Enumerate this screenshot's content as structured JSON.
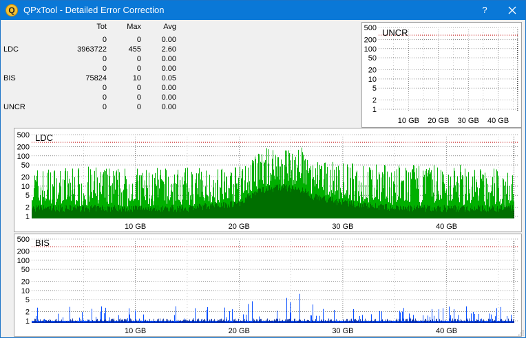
{
  "window": {
    "title": "QPxTool - Detailed Error Correction",
    "help_label": "?",
    "icon_letter": "Q"
  },
  "stats": {
    "headers": {
      "tot": "Tot",
      "max": "Max",
      "avg": "Avg"
    },
    "rows": [
      {
        "label": "",
        "tot": "0",
        "max": "0",
        "avg": "0.00"
      },
      {
        "label": "LDC",
        "tot": "3963722",
        "max": "455",
        "avg": "2.60"
      },
      {
        "label": "",
        "tot": "0",
        "max": "0",
        "avg": "0.00"
      },
      {
        "label": "",
        "tot": "0",
        "max": "0",
        "avg": "0.00"
      },
      {
        "label": "BIS",
        "tot": "75824",
        "max": "10",
        "avg": "0.05"
      },
      {
        "label": "",
        "tot": "0",
        "max": "0",
        "avg": "0.00"
      },
      {
        "label": "",
        "tot": "0",
        "max": "0",
        "avg": "0.00"
      },
      {
        "label": "UNCR",
        "tot": "0",
        "max": "0",
        "avg": "0.00"
      }
    ]
  },
  "colors": {
    "titlebar": "#0a78d7",
    "ldc_fill": "#00b000",
    "ldc_dark": "#006400",
    "bis_fill": "#0a50ff",
    "bis_dark": "#0026a0",
    "threshold_line": "#c00000",
    "grid": "#000000"
  },
  "chart_data": [
    {
      "id": "uncr",
      "type": "bar",
      "title": "UNCR",
      "y_scale": "log",
      "y_ticks": [
        "500",
        "200",
        "100",
        "50",
        "20",
        "10",
        "5",
        "2",
        "1"
      ],
      "x_ticks": [
        "10 GB",
        "20 GB",
        "30 GB",
        "40 GB"
      ],
      "x_range_gb": [
        0,
        47
      ],
      "disc_end_gb": 46.5,
      "threshold": 280,
      "values": []
    },
    {
      "id": "ldc",
      "type": "bar",
      "title": "LDC",
      "y_scale": "log",
      "y_ticks": [
        "500",
        "200",
        "100",
        "50",
        "20",
        "10",
        "5",
        "2",
        "1"
      ],
      "x_ticks": [
        "10 GB",
        "20 GB",
        "30 GB",
        "40 GB"
      ],
      "x_range_gb": [
        0,
        47
      ],
      "disc_end_gb": 46.5,
      "threshold": 280,
      "profile_gb": [
        0,
        5,
        10,
        15,
        20,
        21,
        22,
        24,
        26,
        27,
        30,
        35,
        40,
        45,
        46.5
      ],
      "profile_peak": [
        40,
        45,
        40,
        40,
        45,
        70,
        150,
        250,
        200,
        70,
        60,
        50,
        55,
        40,
        40
      ],
      "profile_base": [
        2,
        2,
        2,
        2,
        3,
        5,
        8,
        10,
        8,
        5,
        3,
        2,
        2,
        2,
        2
      ]
    },
    {
      "id": "bis",
      "type": "bar",
      "title": "BIS",
      "y_scale": "log",
      "y_ticks": [
        "500",
        "200",
        "100",
        "50",
        "20",
        "10",
        "5",
        "2",
        "1"
      ],
      "x_ticks": [
        "10 GB",
        "20 GB",
        "30 GB",
        "40 GB"
      ],
      "x_range_gb": [
        0,
        47
      ],
      "disc_end_gb": 46.5,
      "threshold": 280,
      "profile_gb": [
        0,
        10,
        20,
        21,
        22,
        24,
        26,
        27,
        30,
        40,
        46.5
      ],
      "profile_peak": [
        3,
        3,
        3,
        4,
        6,
        9,
        8,
        4,
        3,
        3,
        3
      ],
      "profile_base": [
        1,
        1,
        1,
        1,
        1,
        1,
        1,
        1,
        1,
        1,
        1
      ]
    }
  ]
}
